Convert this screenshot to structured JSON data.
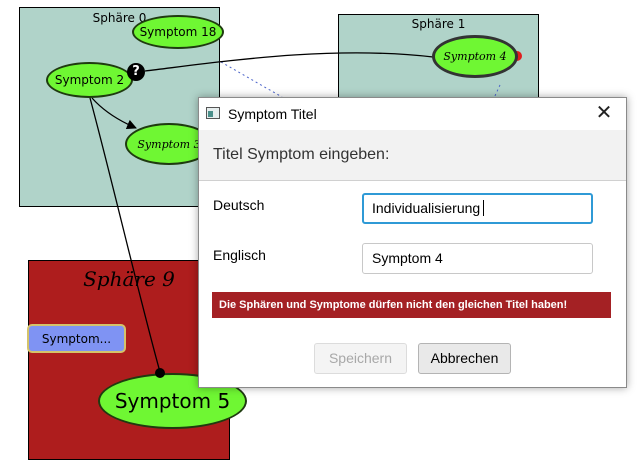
{
  "canvas": {
    "spheres": [
      {
        "title": "Sphäre 0",
        "color": "#b0d3c9"
      },
      {
        "title": "Sphäre 1",
        "color": "#b0d3c9"
      },
      {
        "title": "Sphäre 9",
        "color": "#ae1d1d"
      }
    ],
    "nodes": {
      "symptom18": "Symptom 18",
      "symptom2": "Symptom 2",
      "symptom3": "Symptom 3",
      "symptom4": "Symptom 4",
      "symptom5": "Symptom 5",
      "collapsed": "Symptom..."
    },
    "node_color": "#6ff733",
    "question_glyph": "?"
  },
  "dialog": {
    "window_title": "Symptom Titel",
    "close_glyph": "✕",
    "header": "Titel Symptom eingeben:",
    "fields": [
      {
        "label": "Deutsch",
        "value": "Individualisierung"
      },
      {
        "label": "Englisch",
        "value": "Symptom 4"
      }
    ],
    "error": "Die Sphären und Symptome dürfen nicht den gleichen Titel haben!",
    "buttons": {
      "save": "Speichern",
      "cancel": "Abbrechen"
    },
    "accent_color": "#2f9ad6",
    "error_color": "#a42124"
  }
}
